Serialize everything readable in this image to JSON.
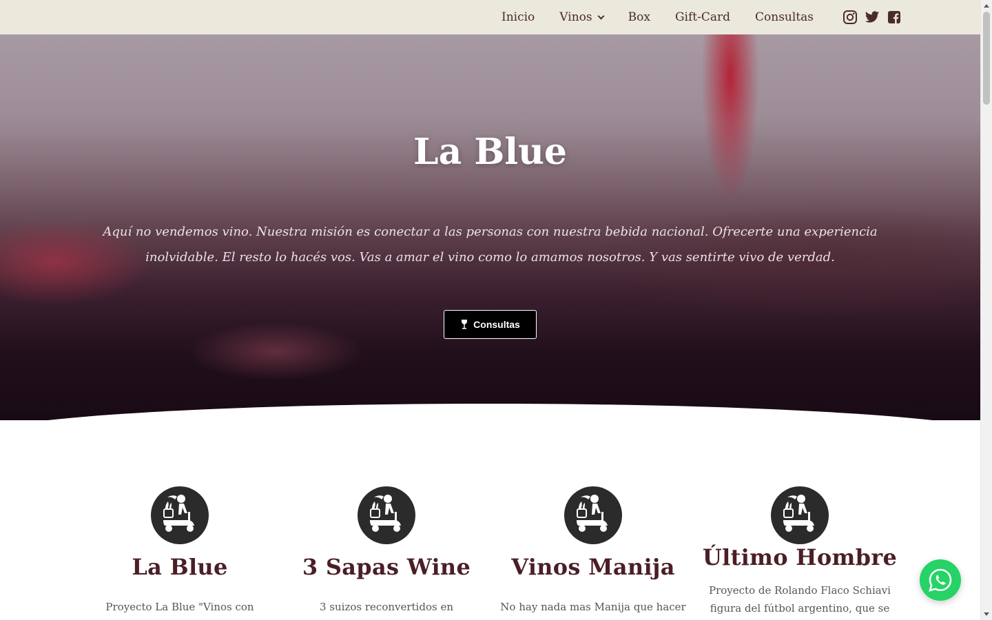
{
  "nav": {
    "items": [
      {
        "label": "Inicio"
      },
      {
        "label": "Vinos",
        "has_dropdown": true
      },
      {
        "label": "Box"
      },
      {
        "label": "Gift-Card"
      },
      {
        "label": "Consultas"
      }
    ],
    "social_icons": [
      "instagram-icon",
      "twitter-icon",
      "facebook-icon"
    ]
  },
  "hero": {
    "title": "La Blue",
    "text": "Aquí no vendemos vino. Nuestra misión es conectar a las personas con nuestra bebida nacional. Ofrecerte una experiencia inolvidable. El resto lo hacés vos. Vas a amar el vino como lo amamos nosotros. Y vas sentirte vivo de verdad.",
    "button_label": "Consultas",
    "button_icon": "wine-glass-icon"
  },
  "cards": [
    {
      "title": "La Blue",
      "description": "Proyecto La Blue \"Vinos con historia\""
    },
    {
      "title": "3 Sapas Wine",
      "description": "3 suizos reconvertidos en"
    },
    {
      "title": "Vinos Manija",
      "description": "No hay nada mas Manija que hacer"
    },
    {
      "title": "Último Hombre",
      "description": "Proyecto de Rolando Flaco Schiavi figura del fútbol argentino, que se"
    }
  ],
  "colors": {
    "header_bg": "#ebe8dc",
    "nav_text": "#4a2b2b",
    "card_title": "#4a1f25",
    "whatsapp": "#25d366"
  },
  "floating": {
    "icon": "whatsapp-icon"
  }
}
